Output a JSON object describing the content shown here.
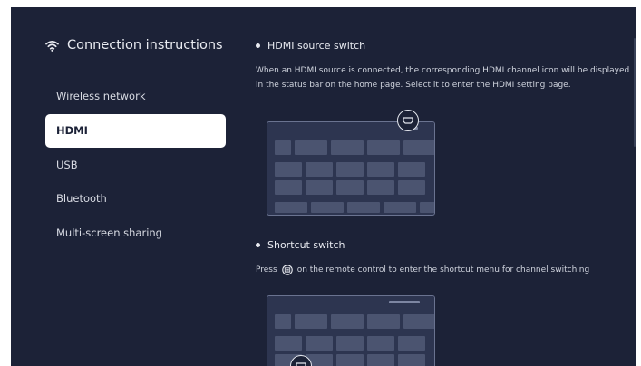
{
  "sidebar": {
    "title": "Connection instructions",
    "title_icon": "wifi-icon",
    "items": [
      {
        "label": "Wireless network",
        "selected": false
      },
      {
        "label": "HDMI",
        "selected": true
      },
      {
        "label": "USB",
        "selected": false
      },
      {
        "label": "Bluetooth",
        "selected": false
      },
      {
        "label": "Multi-screen sharing",
        "selected": false
      }
    ]
  },
  "content": {
    "sections": [
      {
        "title": "HDMI source switch",
        "description": "When an HDMI source is connected, the corresponding HDMI channel icon will be displayed in the status bar on the home page. Select it to enter the HDMI setting page.",
        "illustration_icon": "hdmi-icon"
      },
      {
        "title": "Shortcut switch",
        "description_before": "Press",
        "inline_icon": "remote-menu-icon",
        "description_after": "on the remote control to enter the shortcut menu for channel switching",
        "illustration_icon": "hdmi-icon"
      }
    ]
  },
  "colors": {
    "background": "#1c2237",
    "selected_item_bg": "#ffffff",
    "text": "#e9ebf1"
  }
}
